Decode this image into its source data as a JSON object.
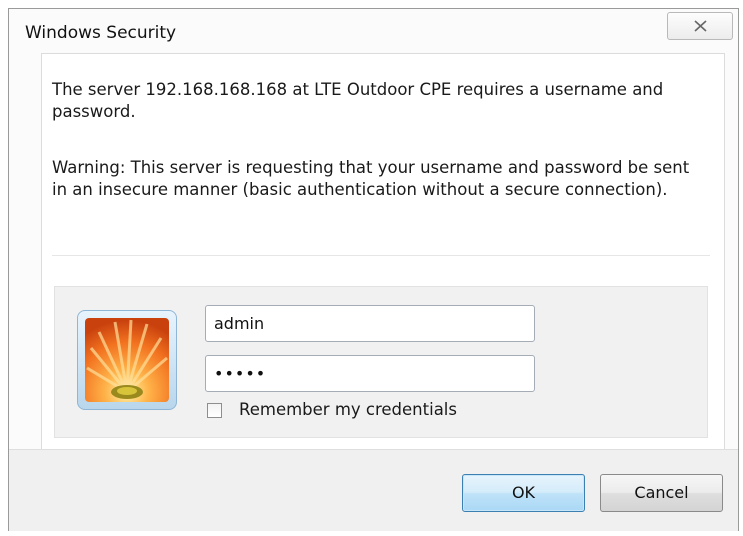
{
  "window": {
    "title": "Windows Security"
  },
  "message": {
    "line1": "The server 192.168.168.168 at LTE Outdoor CPE requires a username and password.",
    "warning": "Warning: This server is requesting that your username and password be sent in an insecure manner (basic authentication without a secure connection)."
  },
  "credentials": {
    "username": "admin",
    "password_masked": "•••••",
    "remember_label": "Remember my credentials",
    "remember_checked": false
  },
  "buttons": {
    "ok": "OK",
    "cancel": "Cancel"
  },
  "icons": {
    "close": "close-icon",
    "user_tile": "user-tile-flower"
  },
  "colors": {
    "ok_border": "#3c7fb1",
    "tile_border": "#8fb6d6"
  }
}
